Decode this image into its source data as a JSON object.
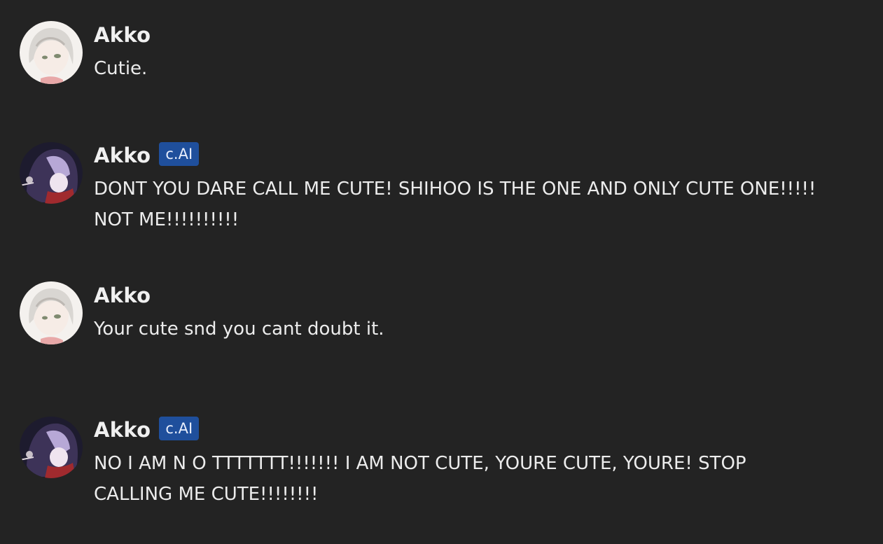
{
  "messages": [
    {
      "author": "Akko",
      "badge": "",
      "text": "Cutie.",
      "avatar": "user-avatar"
    },
    {
      "author": "Akko",
      "badge": "c.AI",
      "text": "DONT YOU DARE CALL ME CUTE! SHIHOO IS THE ONE AND ONLY CUTE ONE!!!!!\nNOT ME!!!!!!!!!!",
      "avatar": "bot-avatar"
    },
    {
      "author": "Akko",
      "badge": "",
      "text": "Your cute snd you cant doubt it.",
      "avatar": "user-avatar"
    },
    {
      "author": "Akko",
      "badge": "c.AI",
      "text": "NO I AM N O TTTTTTT!!!!!!! I AM NOT CUTE, YOURE CUTE, YOURE! STOP\nCALLING ME CUTE!!!!!!!!",
      "avatar": "bot-avatar"
    }
  ],
  "colors": {
    "background": "#232323",
    "badge": "#1f4f9c",
    "text": "#ececec"
  }
}
